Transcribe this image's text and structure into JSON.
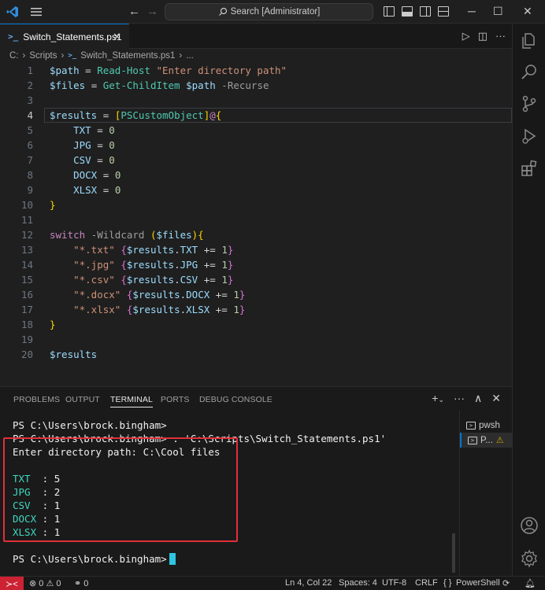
{
  "titlebar": {
    "search_text": "Search [Administrator]"
  },
  "tab": {
    "filename": "Switch_Statements.ps1"
  },
  "breadcrumb": {
    "drive": "C:",
    "folder": "Scripts",
    "file": "Switch_Statements.ps1",
    "more": "..."
  },
  "editor": {
    "line_numbers": [
      "1",
      "2",
      "3",
      "4",
      "5",
      "6",
      "7",
      "8",
      "9",
      "10",
      "11",
      "12",
      "13",
      "14",
      "15",
      "16",
      "17",
      "18",
      "19",
      "20"
    ],
    "active_line": "4"
  },
  "panel": {
    "tabs": [
      "PROBLEMS",
      "OUTPUT",
      "TERMINAL",
      "PORTS",
      "DEBUG CONSOLE"
    ],
    "active_tab": "TERMINAL"
  },
  "terminal": {
    "lines": [
      "PS C:\\Users\\brock.bingham>",
      "PS C:\\Users\\brock.bingham> . 'C:\\Scripts\\Switch_Statements.ps1'",
      "Enter directory path: C:\\Cool files",
      "",
      "TXT  : 5",
      "JPG  : 2",
      "CSV  : 1",
      "DOCX : 1",
      "XLSX : 1",
      "",
      "PS C:\\Users\\brock.bingham>"
    ],
    "results": [
      {
        "key": "TXT ",
        "value": "5"
      },
      {
        "key": "JPG ",
        "value": "2"
      },
      {
        "key": "CSV ",
        "value": "1"
      },
      {
        "key": "DOCX",
        "value": "1"
      },
      {
        "key": "XLSX",
        "value": "1"
      }
    ],
    "list": [
      {
        "label": "pwsh"
      },
      {
        "label": "P..."
      }
    ]
  },
  "statusbar": {
    "errors": "0",
    "warnings": "0",
    "ports": "0",
    "position": "Ln 4, Col 22",
    "spaces": "Spaces: 4",
    "encoding": "UTF-8",
    "eol": "CRLF",
    "language_braces": "{ }",
    "language": "PowerShell"
  },
  "colors": {
    "accent": "#0078d4",
    "highlight_box": "#e0303a",
    "terminal_key": "#3ed8c1"
  }
}
